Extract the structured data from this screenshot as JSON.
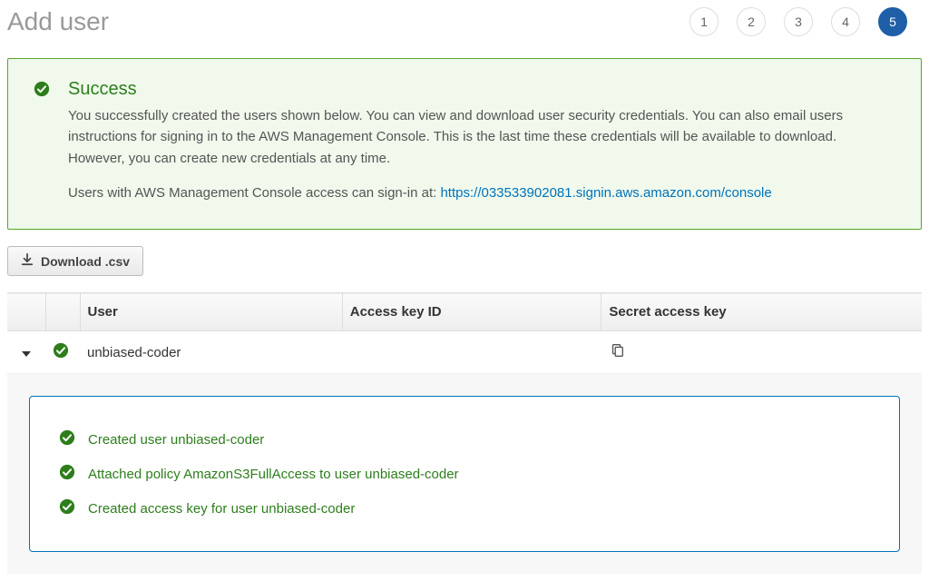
{
  "header": {
    "title": "Add user",
    "steps": [
      "1",
      "2",
      "3",
      "4",
      "5"
    ],
    "active_step_index": 4
  },
  "success": {
    "title": "Success",
    "text": "You successfully created the users shown below. You can view and download user security credentials. You can also email users instructions for signing in to the AWS Management Console. This is the last time these credentials will be available to download. However, you can create new credentials at any time.",
    "signin_prefix": "Users with AWS Management Console access can sign-in at: ",
    "signin_url": "https://033533902081.signin.aws.amazon.com/console"
  },
  "download_label": "Download .csv",
  "table": {
    "headers": {
      "user": "User",
      "access_key_id": "Access key ID",
      "secret_access_key": "Secret access key"
    },
    "row": {
      "username": "unbiased-coder"
    }
  },
  "details": {
    "items": [
      "Created user unbiased-coder",
      "Attached policy AmazonS3FullAccess to user unbiased-coder",
      "Created access key for user unbiased-coder"
    ]
  },
  "colors": {
    "green": "#2e7d1c",
    "link": "#0073bb",
    "step_active": "#1e5fa8"
  }
}
